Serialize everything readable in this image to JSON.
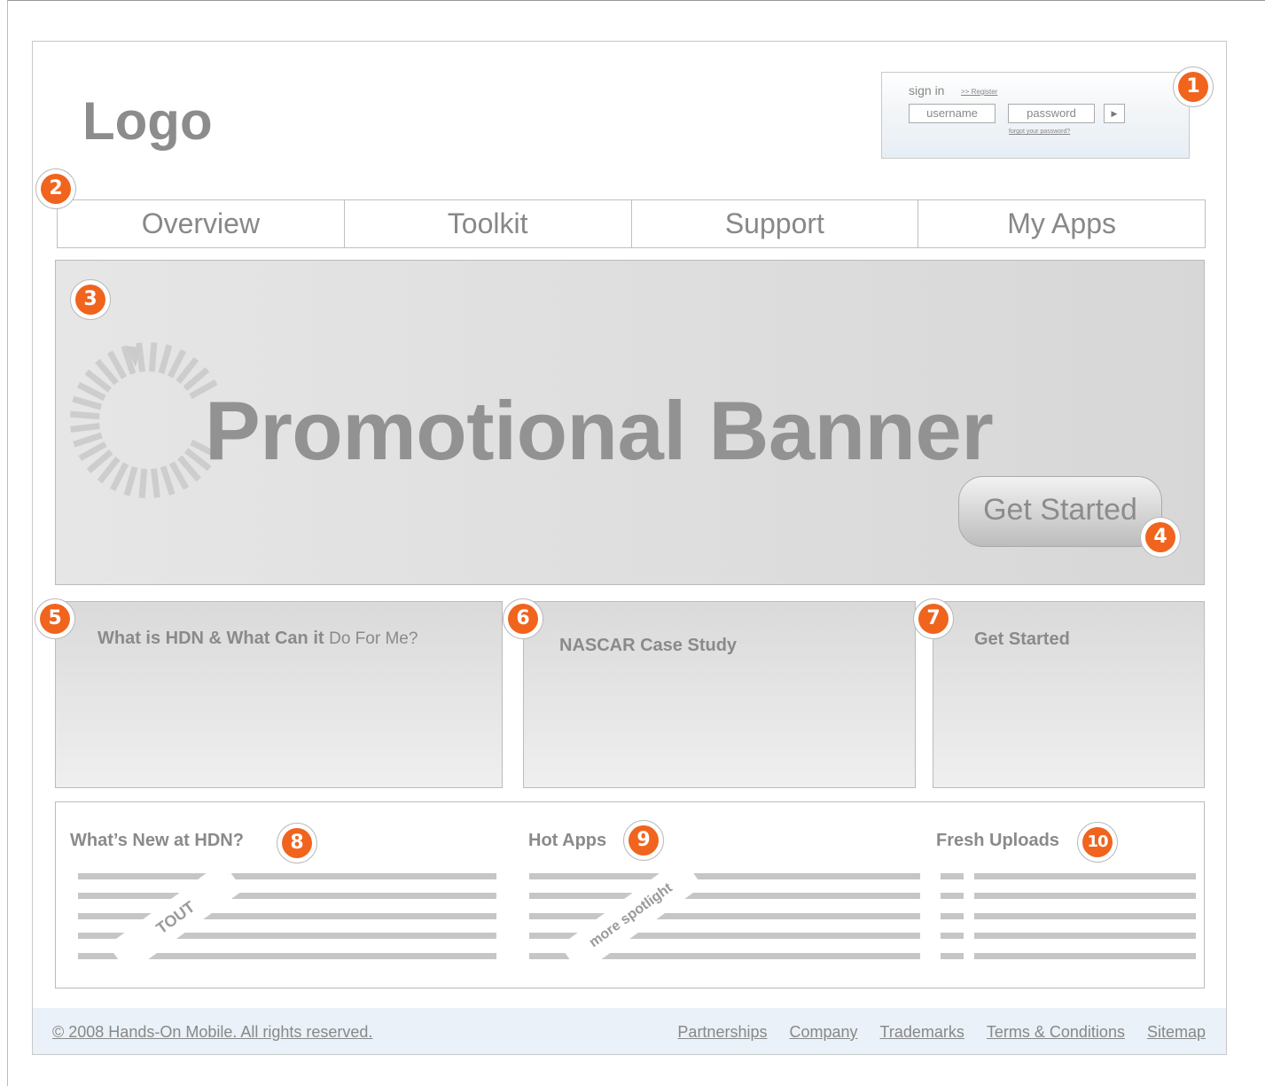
{
  "header": {
    "logo": "Logo"
  },
  "signin": {
    "label": "sign in",
    "register": ">> Register",
    "username_placeholder": "username",
    "password_placeholder": "password",
    "submit_icon": "play-icon",
    "forgot": "forgot your password?"
  },
  "nav": {
    "items": [
      "Overview",
      "Toolkit",
      "Support",
      "My Apps"
    ]
  },
  "banner": {
    "title": "Promotional Banner",
    "cta": "Get Started",
    "icon": "loading-spinner-icon"
  },
  "cards": [
    {
      "title_bold": "What is HDN & What Can it",
      "title_light": "Do For Me?"
    },
    {
      "title_bold": "NASCAR Case Study"
    },
    {
      "title_bold": "Get Started"
    }
  ],
  "sections": [
    {
      "title": "What’s New at HDN?",
      "tag": "TOUT"
    },
    {
      "title": "Hot Apps",
      "tag": "more spotlight"
    },
    {
      "title": "Fresh Uploads"
    }
  ],
  "badges": [
    "1",
    "2",
    "3",
    "4",
    "5",
    "6",
    "7",
    "8",
    "9",
    "10"
  ],
  "footer": {
    "copyright": "© 2008 Hands-On Mobile. All rights reserved.",
    "links": [
      "Partnerships",
      "Company",
      "Trademarks",
      "Terms & Conditions",
      "Sitemap"
    ]
  },
  "colors": {
    "accent": "#f0641e",
    "footer_bg": "#eaf1f8",
    "text": "#888888"
  }
}
